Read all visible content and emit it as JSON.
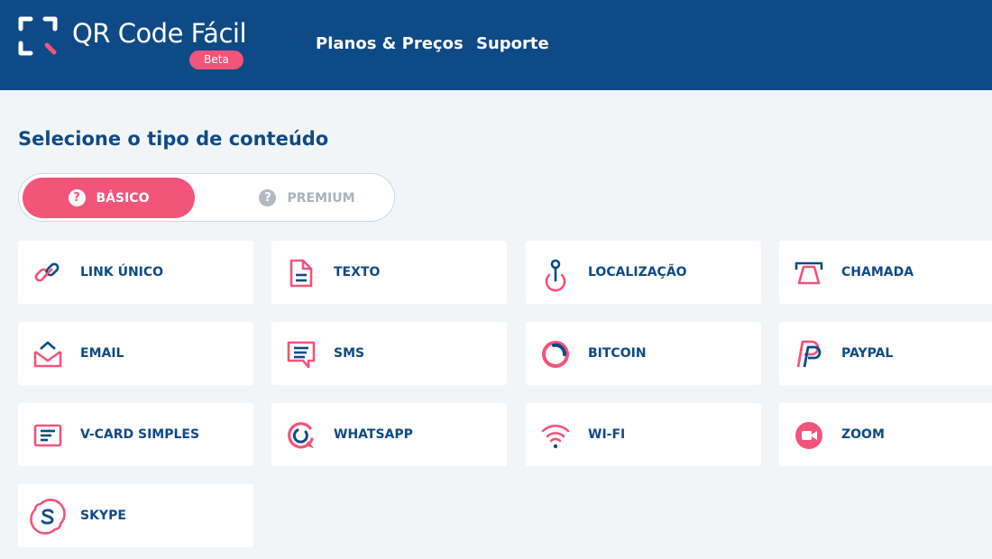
{
  "header": {
    "logo_text": "QR Code Fácil",
    "badge": "Beta",
    "nav": [
      {
        "label": "Planos & Preços"
      },
      {
        "label": "Suporte"
      }
    ]
  },
  "colors": {
    "primary": "#0e4a86",
    "accent": "#f2547a",
    "background": "#f2f5f8"
  },
  "page": {
    "title": "Selecione o tipo de conteúdo"
  },
  "toggle": {
    "basic_label": "BÁSICO",
    "premium_label": "PREMIUM",
    "selected": "basic",
    "help_glyph": "?"
  },
  "content_types": [
    {
      "label": "LINK ÚNICO",
      "icon": "link-icon"
    },
    {
      "label": "TEXTO",
      "icon": "document-icon"
    },
    {
      "label": "LOCALIZAÇÃO",
      "icon": "location-pin-icon"
    },
    {
      "label": "CHAMADA",
      "icon": "phone-icon"
    },
    {
      "label": "EMAIL",
      "icon": "envelope-icon"
    },
    {
      "label": "SMS",
      "icon": "message-icon"
    },
    {
      "label": "BITCOIN",
      "icon": "bitcoin-icon"
    },
    {
      "label": "PAYPAL",
      "icon": "paypal-icon"
    },
    {
      "label": "V-CARD SIMPLES",
      "icon": "vcard-icon"
    },
    {
      "label": "WHATSAPP",
      "icon": "whatsapp-icon"
    },
    {
      "label": "WI-FI",
      "icon": "wifi-icon"
    },
    {
      "label": "ZOOM",
      "icon": "video-camera-icon"
    },
    {
      "label": "SKYPE",
      "icon": "skype-icon"
    }
  ]
}
